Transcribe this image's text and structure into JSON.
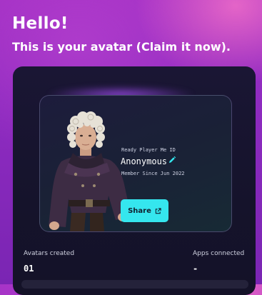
{
  "header": {
    "greeting": "Hello!",
    "subtitle": "This is your avatar  (Claim it now)."
  },
  "profile_card": {
    "id_label": "Ready Player Me ID",
    "username": "Anonymous",
    "member_since": "Member Since Jun 2022",
    "share_label": "Share",
    "avatar_icon": "avatar-3d-character",
    "edit_icon": "pencil-icon",
    "share_icon": "external-link-icon"
  },
  "stats": {
    "avatars_created_label": "Avatars created",
    "avatars_created_value": "01",
    "apps_connected_label": "Apps connected",
    "apps_connected_value": "-"
  },
  "colors": {
    "background": "#8f2bc0",
    "panel": "#16132c",
    "accent": "#35e6ee"
  }
}
